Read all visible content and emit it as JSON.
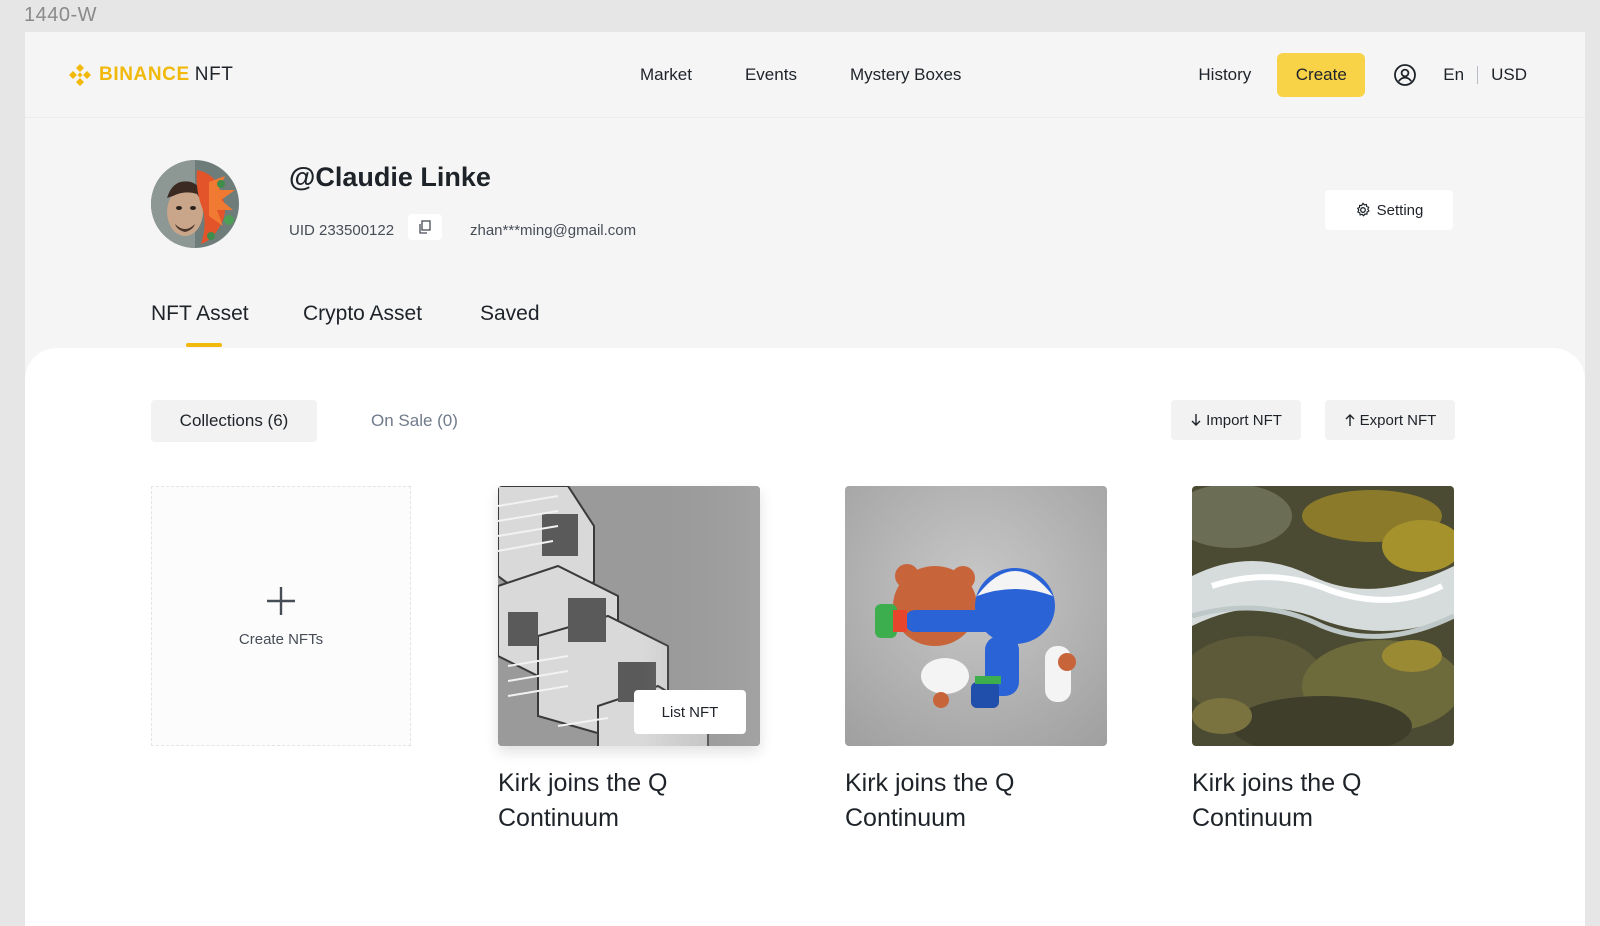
{
  "frame_label": "1440-W",
  "brand": {
    "name": "BINANCE",
    "suffix": "NFT",
    "accent_color": "#f0b90b"
  },
  "nav": {
    "links": [
      "Market",
      "Events",
      "Mystery Boxes"
    ],
    "history": "History",
    "create": "Create",
    "language": "En",
    "currency": "USD",
    "user_icon": "user-circle-icon"
  },
  "profile": {
    "username": "@Claudie Linke",
    "uid": "UID 233500122",
    "copy_icon": "copy-icon",
    "email": "zhan***ming@gmail.com",
    "setting": "Setting",
    "setting_icon": "gear-icon"
  },
  "tabs": [
    {
      "label": "NFT Asset",
      "active": true
    },
    {
      "label": "Crypto Asset",
      "active": false
    },
    {
      "label": "Saved",
      "active": false
    }
  ],
  "filters": {
    "collections": "Collections (6)",
    "on_sale": "On Sale (0)"
  },
  "actions": {
    "import": "Import NFT",
    "import_icon": "arrow-down-icon",
    "export": "Export NFT",
    "export_icon": "arrow-up-icon"
  },
  "create_card": {
    "label": "Create NFTs",
    "icon": "plus-icon"
  },
  "nfts": [
    {
      "title": "Kirk joins the Q Continuum",
      "list_label": "List NFT",
      "image": "architecture-photo"
    },
    {
      "title": "Kirk joins the Q Continuum",
      "image": "toy-figure-render"
    },
    {
      "title": "Kirk joins the Q Continuum",
      "image": "river-water-photo"
    }
  ]
}
